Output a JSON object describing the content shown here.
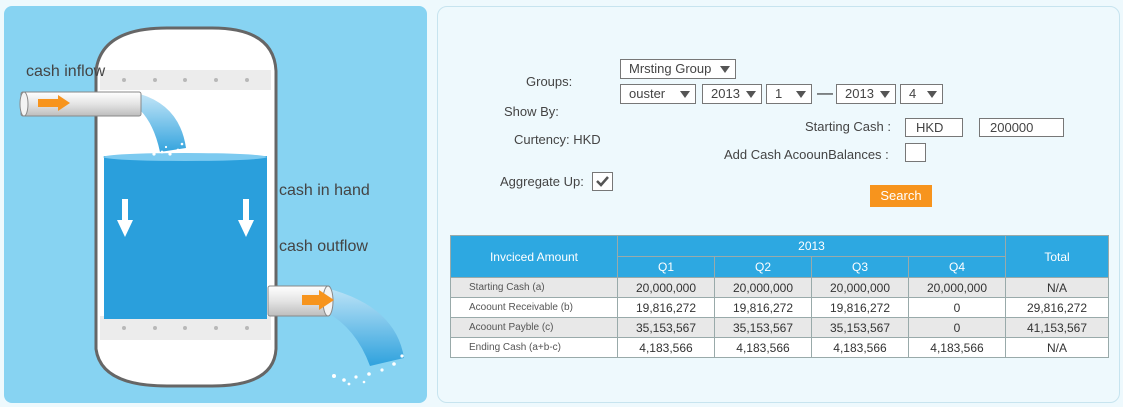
{
  "diagram": {
    "cash_inflow_label": "cash inflow",
    "cash_in_hand_label": "cash in hand",
    "cash_outflow_label": "cash outflow"
  },
  "form": {
    "groups_label": "Groups:",
    "show_by_label": "Show By:",
    "currency_label": "Curtency: HKD",
    "aggregate_label": "Aggregate Up:",
    "group_select": "Mrsting Group",
    "show_by_select": "ouster",
    "start_year": "2013",
    "start_quarter": "1",
    "range_dash": "—",
    "end_year": "2013",
    "end_quarter": "4",
    "starting_cash_label": "Starting  Cash :",
    "starting_cash_currency": "HKD",
    "starting_cash_amount": "200000",
    "add_balances_label": "Add Cash AcoounBalances :",
    "add_balances_checked": false,
    "aggregate_checked": true,
    "search_label": "Search"
  },
  "table": {
    "corner_header": "Invciced  Amount",
    "year_header": "2013",
    "total_header": "Total",
    "quarters": [
      "Q1",
      "Q2",
      "Q3",
      "Q4"
    ],
    "rows": [
      {
        "label": "Starting  Cash (a)",
        "values": [
          "20,000,000",
          "20,000,000",
          "20,000,000",
          "20,000,000"
        ],
        "total": "N/A"
      },
      {
        "label": "Acoount  Receivable (b)",
        "values": [
          "19,816,272",
          "19,816,272",
          "19,816,272",
          "0"
        ],
        "total": "29,816,272"
      },
      {
        "label": "Acoount  Payble (c)",
        "values": [
          "35,153,567",
          "35,153,567",
          "35,153,567",
          "0"
        ],
        "total": "41,153,567"
      },
      {
        "label": "Ending  Cash  (a+b-c)",
        "values": [
          "4,183,566",
          "4,183,566",
          "4,183,566",
          "4,183,566"
        ],
        "total": "N/A"
      }
    ]
  },
  "colors": {
    "left_panel_bg": "#87d3f2",
    "water_blue": "#2a9fdc",
    "arrow_orange": "#f7941d",
    "header_blue": "#2da8e1",
    "search_orange": "#f7941d"
  }
}
